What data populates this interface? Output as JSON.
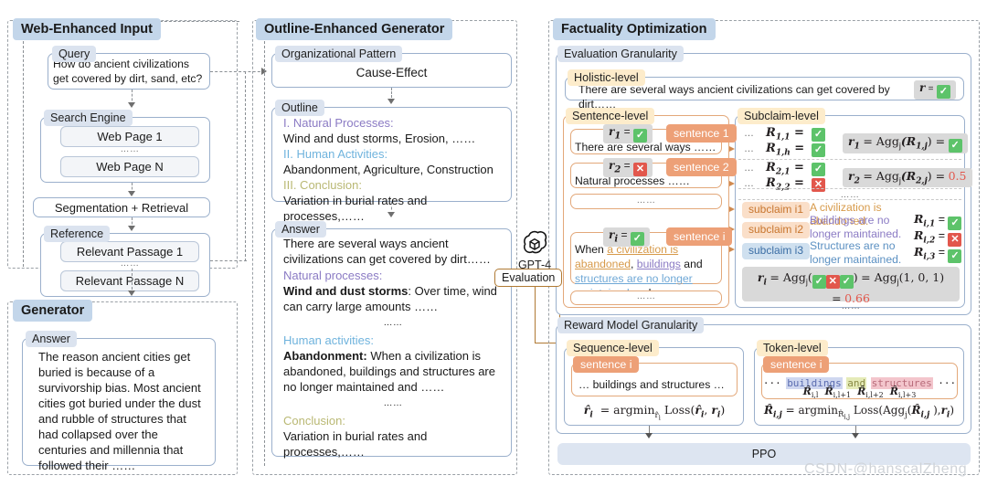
{
  "panels": {
    "left": {
      "title": "Web-Enhanced Input",
      "query": {
        "label": "Query",
        "text": "How do ancient civilizations get covered by dirt, sand, etc?"
      },
      "search_engine": {
        "label": "Search Engine",
        "items": [
          "Web Page 1",
          "Web Page N"
        ],
        "ellipsis": "……"
      },
      "segmentation": "Segmentation + Retrieval",
      "reference": {
        "label": "Reference",
        "items": [
          "Relevant Passage 1",
          "Relevant Passage N"
        ],
        "ellipsis": "……"
      },
      "generator": {
        "title": "Generator",
        "answer_label": "Answer",
        "answer_text": "The reason ancient cities get buried is because of a survivorship bias. Most ancient cities got buried under the dust and rubble of structures that had collapsed over the centuries and millennia that followed their ……"
      }
    },
    "middle": {
      "title": "Outline-Enhanced Generator",
      "org_pattern": {
        "label": "Organizational Pattern",
        "value": "Cause-Effect"
      },
      "outline": {
        "label": "Outline",
        "lines": [
          {
            "head": "I. Natural Processes:",
            "body": "Wind and dust storms, Erosion, ……"
          },
          {
            "head": "II. Human Activities:",
            "body": "Abandonment, Agriculture, Construction"
          },
          {
            "head": "III. Conclusion:",
            "body": "Variation in burial rates and processes,……"
          }
        ]
      },
      "answer": {
        "label": "Answer",
        "intro": "There are several ways ancient civilizations can get covered by dirt……",
        "sec1_head": "Natural processes:",
        "sec1_bold": "Wind and dust storms",
        "sec1_body": ": Over time, wind can carry large amounts ……",
        "ellipsis": "……",
        "sec2_head": "Human activities:",
        "sec2_bold": "Abandonment:",
        "sec2_body": " When a civilization is abandoned, buildings and structures are no longer maintained and ……",
        "sec3_head": "Conclusion:",
        "sec3_body": "Variation in burial rates and processes,……"
      }
    },
    "model": {
      "name": "GPT-4",
      "icon": "openai-logo-icon",
      "evaluation_label": "Evaluation"
    },
    "right": {
      "title": "Factuality Optimization",
      "eval_granularity": {
        "label": "Evaluation Granularity",
        "holistic": {
          "label": "Holistic-level",
          "text": "There are several ways ancient civilizations can get covered by dirt……",
          "score_var": "r",
          "score_eq": "=",
          "score_mark": "check"
        },
        "sentence_level": {
          "label": "Sentence-level",
          "rows": [
            {
              "var": "r",
              "sub": "1",
              "mark": "check",
              "tag": "sentence 1",
              "text": "There are several ways  ……"
            },
            {
              "var": "r",
              "sub": "2",
              "mark": "cross",
              "tag": "sentence 2",
              "text": "Natural processes ……"
            }
          ],
          "ellipsis": "……",
          "row_i": {
            "var": "r",
            "sub": "i",
            "mark": "check",
            "tag": "sentence i",
            "prefix": "When ",
            "hl_orange": "a civilization is abandoned",
            "mid1": ", ",
            "hl_purple": "buildings",
            "mid2": " and ",
            "hl_blue": "structures are no longer maintained",
            "suffix": " and ……"
          },
          "ellipsis2": "……"
        },
        "subclaim_level": {
          "label": "Subclaim-level",
          "groups": [
            {
              "rows": [
                {
                  "dots": "…",
                  "var": "R",
                  "sub": "1,1",
                  "mark": "check"
                },
                {
                  "dots": "…",
                  "var": "R",
                  "sub": "1,h",
                  "mark": "check"
                }
              ],
              "agg": {
                "lhs": "r",
                "lhs_sub": "1",
                "expr": "= Agg",
                "expr_sub": "j",
                "arg": "(R",
                "arg_sub": "1,j",
                "arg_end": ") =",
                "result_mark": "check",
                "result_value": ""
              }
            },
            {
              "rows": [
                {
                  "dots": "…",
                  "var": "R",
                  "sub": "2,1",
                  "mark": "check"
                },
                {
                  "dots": "…",
                  "var": "R",
                  "sub": "2,2",
                  "mark": "cross"
                }
              ],
              "agg": {
                "lhs": "r",
                "lhs_sub": "2",
                "expr": "= Agg",
                "expr_sub": "j",
                "arg": "(R",
                "arg_sub": "2,j",
                "arg_end": ") =",
                "result_mark": "",
                "result_value": "0.5"
              }
            }
          ],
          "group_ellipsis": "……",
          "subclaims": [
            {
              "tag": "subclaim i1",
              "text": "A civilization is abandoned.",
              "var": "R",
              "sub": "i,1",
              "mark": "check",
              "color": "orange"
            },
            {
              "tag": "subclaim i2",
              "text": "Buildings are no longer maintained.",
              "var": "R",
              "sub": "i,2",
              "mark": "cross",
              "color": "purple"
            },
            {
              "tag": "subclaim i3",
              "text": "Structures are no longer maintained.",
              "var": "R",
              "sub": "i,3",
              "mark": "check",
              "color": "blue"
            }
          ],
          "final": {
            "lhs": "r",
            "lhs_sub": "i",
            "eq": "= Agg",
            "eq_sub": "j",
            "open": "(",
            "marks": [
              "check",
              "cross",
              "check"
            ],
            "close": ")",
            "mid": "= Agg",
            "mid_sub": "j",
            "nums": "(1, 0, 1)",
            "result_eq": "=",
            "result": "0.66"
          },
          "tail_ellipsis": "……"
        }
      },
      "reward_granularity": {
        "label": "Reward Model Granularity",
        "sequence_level": {
          "label": "Sequence-level",
          "tag": "sentence i",
          "text": "… buildings and structures …",
          "formula": "= argmin     Loss(     ,    )"
        },
        "token_level": {
          "label": "Token-level",
          "tag": "sentence i",
          "tokens": [
            "···",
            "buildings",
            "and",
            "structures",
            "···"
          ],
          "subscripts": [
            "i,l",
            "i,l+1",
            "i,l+2",
            "i,l+3"
          ],
          "formula": "= argmin     Loss(Agg ( ), )"
        },
        "ppo": "PPO"
      }
    }
  },
  "watermark": "CSDN-@hanscalZheng",
  "colors": {
    "title_chip": "#c3d6ea",
    "label_chip": "#dbe3ef",
    "cream_chip": "#fdeccb",
    "salmon_chip": "#eda077",
    "check_green": "#5dc36a",
    "cross_red": "#e2574c",
    "ppo_bar": "#dde5f1"
  }
}
